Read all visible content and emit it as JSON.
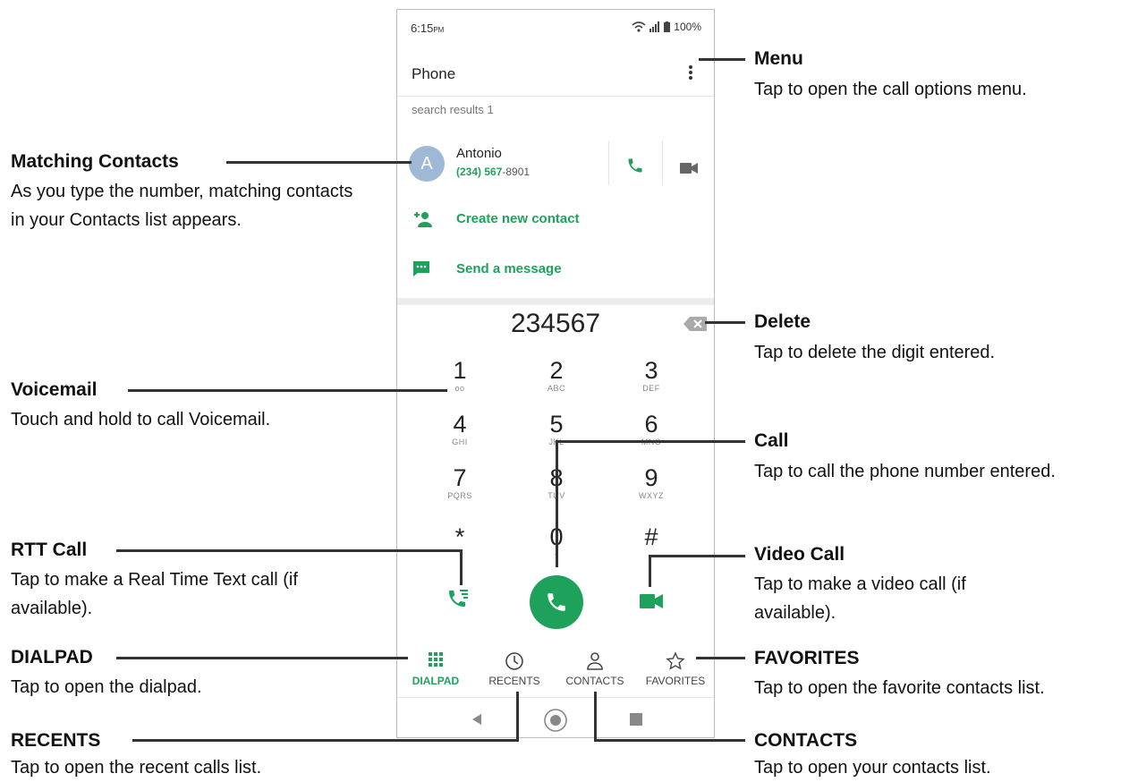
{
  "status": {
    "time": "6:15",
    "ampm": "PM",
    "battery": "100%"
  },
  "appbar": {
    "title": "Phone"
  },
  "search": {
    "label": "search results 1"
  },
  "contact": {
    "initial": "A",
    "name": "Antonio",
    "number_match": "(234) 567",
    "number_rest": "-8901"
  },
  "actions": {
    "create": "Create new contact",
    "message": "Send a message"
  },
  "dial": {
    "number": "234567"
  },
  "keys": [
    {
      "digit": "1",
      "sub": "ᴏᴏ"
    },
    {
      "digit": "2",
      "sub": "ABC"
    },
    {
      "digit": "3",
      "sub": "DEF"
    },
    {
      "digit": "4",
      "sub": "GHI"
    },
    {
      "digit": "5",
      "sub": "JKL"
    },
    {
      "digit": "6",
      "sub": "MNO"
    },
    {
      "digit": "7",
      "sub": "PQRS"
    },
    {
      "digit": "8",
      "sub": "TUV"
    },
    {
      "digit": "9",
      "sub": "WXYZ"
    },
    {
      "digit": "*",
      "sub": ""
    },
    {
      "digit": "0",
      "sub": "+"
    },
    {
      "digit": "#",
      "sub": ""
    }
  ],
  "tabs": {
    "dialpad": "DIALPAD",
    "recents": "RECENTS",
    "contacts": "CONTACTS",
    "favorites": "FAVORITES"
  },
  "annotations": {
    "menu": {
      "title": "Menu",
      "text": "Tap to open the call options menu."
    },
    "matching": {
      "title": "Matching Contacts",
      "text": "As you type the number, matching contacts in your Contacts list appears."
    },
    "delete": {
      "title": "Delete",
      "text": "Tap to delete the digit entered."
    },
    "voicemail": {
      "title": "Voicemail",
      "text": "Touch and hold to call Voicemail."
    },
    "call": {
      "title": "Call",
      "text": "Tap to call the phone number entered."
    },
    "rtt": {
      "title": "RTT Call",
      "text": "Tap to make a Real Time Text call (if available)."
    },
    "video": {
      "title": "Video Call",
      "text": "Tap to make a video call (if available)."
    },
    "dialpad": {
      "title": "DIALPAD",
      "text": "Tap to open the dialpad."
    },
    "favorites": {
      "title": "FAVORITES",
      "text": "Tap to open the favorite contacts list."
    },
    "recents": {
      "title": "RECENTS",
      "text": "Tap to open the recent calls list."
    },
    "contacts": {
      "title": "CONTACTS",
      "text": "Tap to open your contacts list."
    }
  },
  "colors": {
    "accent": "#1ea25b",
    "avatar": "#9fb8d6"
  }
}
